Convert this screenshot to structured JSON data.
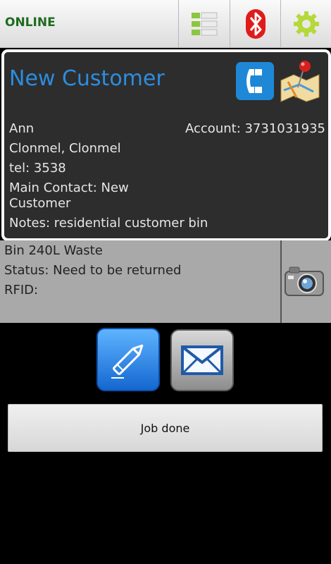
{
  "topbar": {
    "status": "ONLINE",
    "list_icon": "list-icon",
    "bluetooth_icon": "bluetooth-icon",
    "settings_icon": "gear-icon"
  },
  "customer": {
    "name": "New Customer",
    "contact": "Ann",
    "account": "Account: 3731031935",
    "address": "Clonmel, Clonmel",
    "tel": "tel: 3538",
    "main_contact": "Main Contact: New Customer",
    "notes": "Notes: residential customer bin",
    "phone_icon": "phone-icon",
    "map_icon": "map-pin-icon"
  },
  "bin": {
    "type": "Bin 240L Waste",
    "status": "Status: Need to be returned",
    "rfid": "RFID:",
    "camera_icon": "camera-icon"
  },
  "actions": {
    "edit_icon": "pen-icon",
    "mail_icon": "envelope-icon",
    "job_done_label": "Job done"
  },
  "colors": {
    "status_green": "#1e6b1e",
    "name_blue": "#2c8de0",
    "card_bg": "#2d2d2d",
    "bin_panel_bg": "#a9a9a9"
  }
}
